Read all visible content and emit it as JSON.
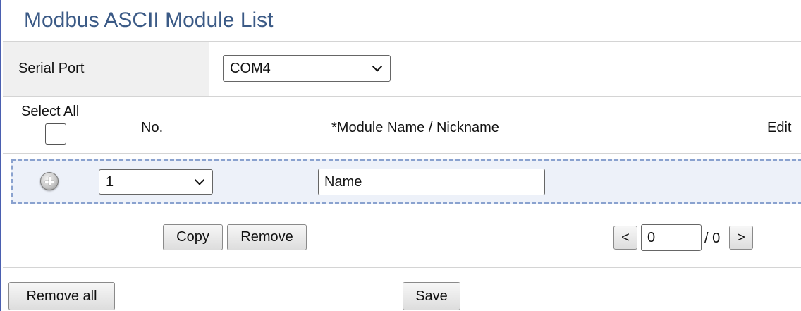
{
  "page": {
    "title": "Modbus ASCII Module List"
  },
  "serial_port": {
    "label": "Serial Port",
    "selected": "COM4"
  },
  "table_header": {
    "select_all": "Select All",
    "no": "No.",
    "module_name": "*Module Name / Nickname",
    "edit": "Edit"
  },
  "new_row": {
    "add_icon": "plus-circle-icon",
    "no_selected": "1",
    "name_value": "Name"
  },
  "actions": {
    "copy": "Copy",
    "remove": "Remove"
  },
  "pager": {
    "prev": "<",
    "page_value": "0",
    "total": "/ 0",
    "next": ">"
  },
  "footer": {
    "remove_all": "Remove all",
    "save": "Save"
  },
  "colors": {
    "title_text": "#3b5a86",
    "left_border": "#4a5fb0",
    "label_cell_bg": "#f0f0f0",
    "row_bg": "#edf1f9",
    "row_dashed_border": "#8aa2cf"
  }
}
